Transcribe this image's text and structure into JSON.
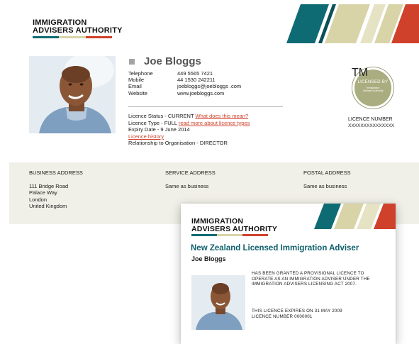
{
  "org": {
    "line1": "IMMIGRATION",
    "line2": "ADVISERS AUTHORITY"
  },
  "brand_colors": {
    "teal": "#0e6b73",
    "dark_teal": "#0b4f58",
    "beige": "#d8d4a8",
    "red": "#d0412b"
  },
  "adviser": {
    "name": "Joe Bloggs"
  },
  "contact": [
    {
      "label": "Telephone",
      "value": "449 5565 7421"
    },
    {
      "label": "Mobile",
      "value": "44 1530 242211"
    },
    {
      "label": "Email",
      "value": "joebloggs@joebloggs .com"
    },
    {
      "label": "Website",
      "value": "www.joebloggs.com"
    }
  ],
  "licence": {
    "status_text": "Licence Status - CURRENT",
    "status_link": "What does this mean?",
    "type_text": "Licence Type - FULL",
    "type_link": "read more about licence types",
    "expiry": "Expiry Date - 9 June 2014",
    "history_link": "Licence history",
    "relationship": "Relationship to Organisation - DIRECTOR"
  },
  "badge": {
    "title": "LICENSED BY",
    "sub1": "Immigration",
    "sub2": "Advisers Authority",
    "tm": "TM"
  },
  "licence_number": {
    "title": "LICENCE NUMBER",
    "value": "XXXXXXXXXXXXXXX"
  },
  "addresses": {
    "business": {
      "title": "BUSINESS ADDRESS",
      "lines": [
        "111 Bridge Road",
        "Palace Way",
        "London",
        "United Kingdom"
      ]
    },
    "service": {
      "title": "SERVICE ADDRESS",
      "lines": [
        "Same as business"
      ]
    },
    "postal": {
      "title": "POSTAL ADDRESS",
      "lines": [
        "Same as business"
      ]
    }
  },
  "certificate": {
    "title": "New Zealand Licensed Immigration Adviser",
    "name": "Joe Bloggs",
    "grant_lines": [
      "HAS BEEN GRANTED A PROVISIONAL LICENCE TO",
      "OPERATE AS AN IMMIGRATION ADVISER UNDER THE",
      "IMMIGRATION ADVISERS LICENSING ACT 2007."
    ],
    "expires": "THIS LICENCE EXPIRES ON 31 MAY 2009",
    "number": "LICENCE NUMBER 0000001"
  }
}
